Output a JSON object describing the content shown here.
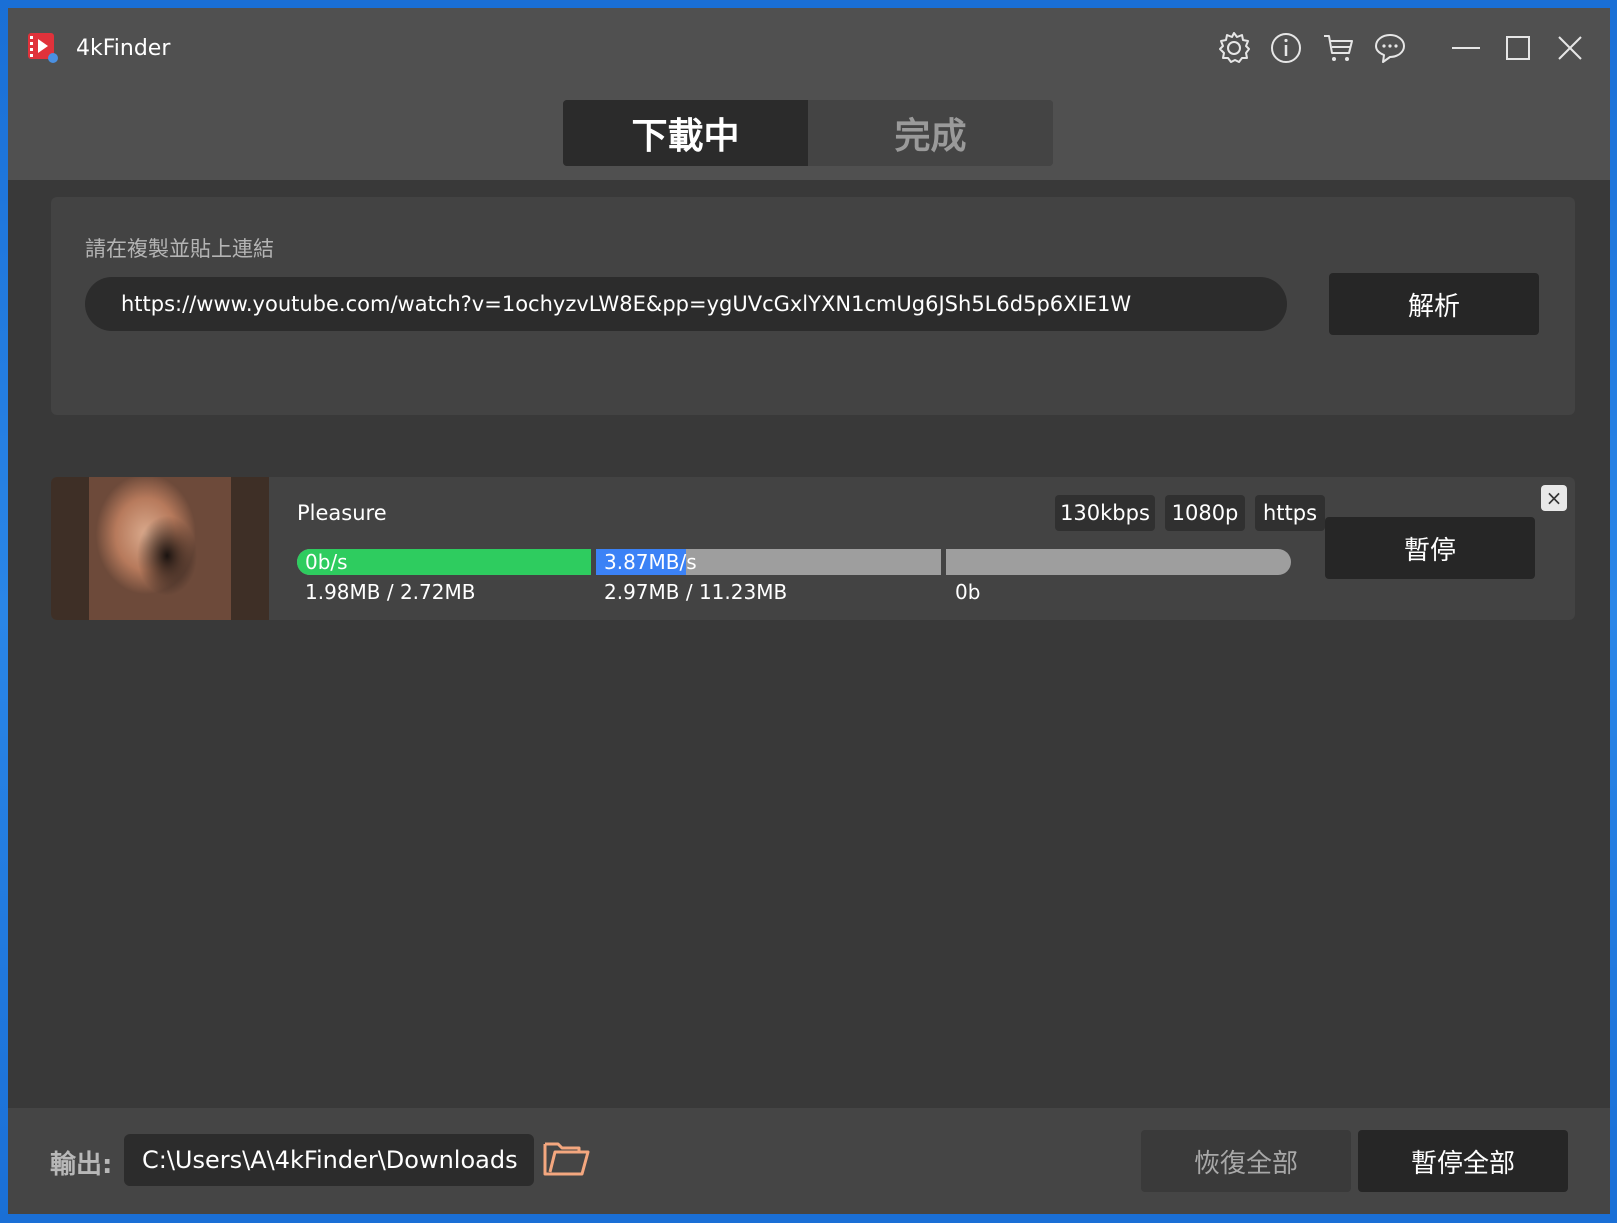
{
  "app": {
    "title": "4kFinder"
  },
  "titlebar": {
    "icons": [
      "gear-icon",
      "info-icon",
      "cart-icon",
      "chat-icon",
      "minimize-icon",
      "maximize-icon",
      "close-icon"
    ]
  },
  "tabs": [
    {
      "label": "下載中",
      "active": true
    },
    {
      "label": "完成",
      "active": false
    }
  ],
  "url_panel": {
    "hint": "請在複製並貼上連結",
    "url_value": "https://www.youtube.com/watch?v=1ochyzvLW8E&pp=ygUVcGxlYXN1cmUg6JSh5L6d5p6XIE1W",
    "parse_label": "解析"
  },
  "download": {
    "title": "Pleasure",
    "badges": [
      "130kbps",
      "1080p",
      "https"
    ],
    "segments": [
      {
        "speed": "0b/s",
        "stat": "1.98MB / 2.72MB",
        "progress": 1.0,
        "color": "#2ecc5f"
      },
      {
        "speed": "3.87MB/s",
        "stat": "2.97MB / 11.23MB",
        "progress": 0.26,
        "color": "#3b82f6"
      },
      {
        "speed": "",
        "stat": "0b",
        "progress": 0.0,
        "color": "#3b82f6"
      }
    ],
    "pause_label": "暫停",
    "remove_label": "×"
  },
  "footer": {
    "output_label": "輸出:",
    "output_path": "C:\\Users\\A\\4kFinder\\Downloads",
    "resume_all_label": "恢復全部",
    "pause_all_label": "暫停全部"
  }
}
